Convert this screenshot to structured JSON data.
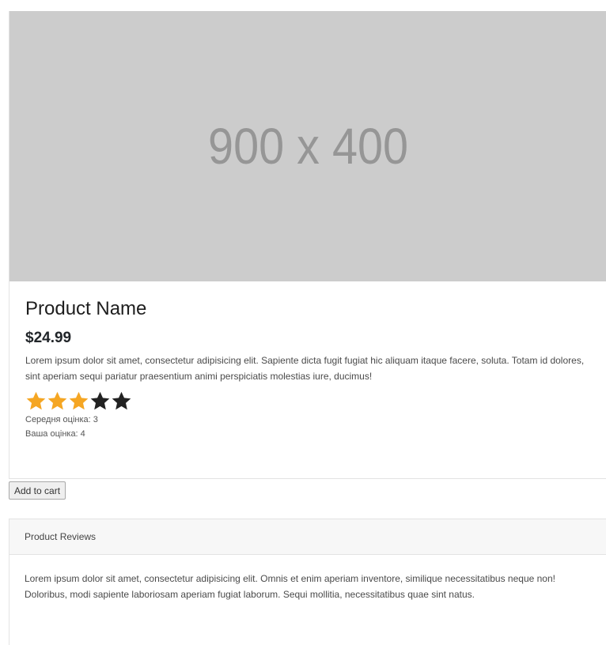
{
  "image": {
    "placeholder_text": "900 x 400",
    "background": "#cccccc"
  },
  "product": {
    "name": "Product Name",
    "price": "$24.99",
    "description": "Lorem ipsum dolor sit amet, consectetur adipisicing elit. Sapiente dicta fugit fugiat hic aliquam itaque facere, soluta. Totam id dolores, sint aperiam sequi pariatur praesentium animi perspiciatis molestias iure, ducimus!"
  },
  "rating": {
    "stars_total": 5,
    "stars_filled": 3,
    "filled_color": "#f5a623",
    "empty_color": "#222222",
    "average_label": "Середня оцінка: 3",
    "your_label": "Ваша оцінка: 4"
  },
  "actions": {
    "add_to_cart_label": "Add to cart"
  },
  "reviews": {
    "header": "Product Reviews",
    "body": "Lorem ipsum dolor sit amet, consectetur adipisicing elit. Omnis et enim aperiam inventore, similique necessitatibus neque non! Doloribus, modi sapiente laboriosam aperiam fugiat laborum. Sequi mollitia, necessitatibus quae sint natus."
  }
}
